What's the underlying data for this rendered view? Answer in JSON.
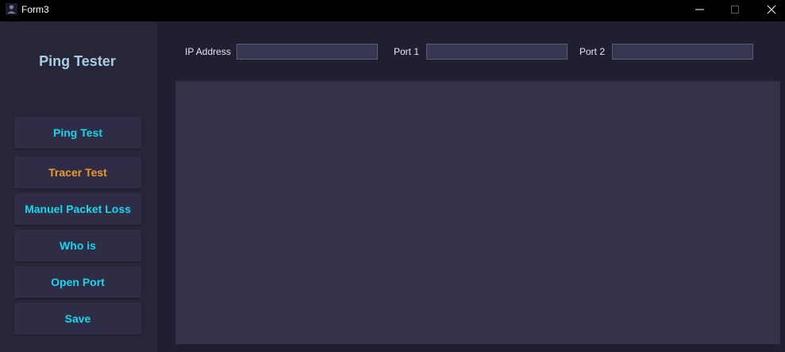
{
  "window": {
    "title": "Form3",
    "icons": [
      "app-icon",
      "minimize-icon",
      "maximize-icon",
      "close-icon"
    ]
  },
  "sidebar": {
    "title": "Ping Tester",
    "items": [
      {
        "label": "Ping Test"
      },
      {
        "label": "Tracer Test"
      },
      {
        "label": "Manuel Packet Loss"
      },
      {
        "label": "Who is"
      },
      {
        "label": "Open Port"
      },
      {
        "label": "Save"
      }
    ]
  },
  "form": {
    "ip_label": "IP Address",
    "ip_value": "",
    "port1_label": "Port 1",
    "port1_value": "",
    "port2_label": "Port 2",
    "port2_value": ""
  },
  "output": {
    "text": ""
  },
  "colors": {
    "titlebar": "#000000",
    "sidebar_bg": "#272639",
    "main_bg": "#201f31",
    "button_bg": "#2e2d45",
    "button_text": "#19d6ee",
    "active_button_text": "#ec9b2a",
    "sidebar_title": "#a8cde2",
    "panel_bg": "#343148",
    "input_bg": "#373650"
  }
}
